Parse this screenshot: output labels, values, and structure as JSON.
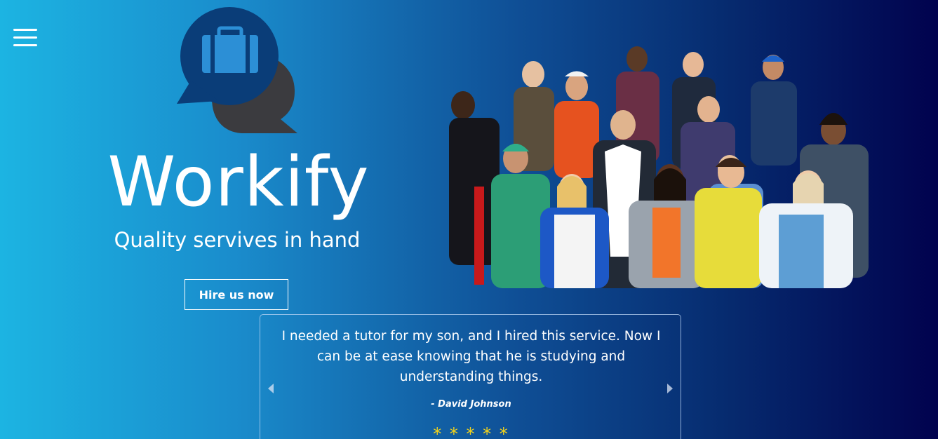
{
  "header": {
    "menu_icon": "hamburger-menu-icon",
    "logo_icon": "briefcase-chat-bubble-logo"
  },
  "hero": {
    "title": "Workify",
    "tagline": "Quality servives in hand",
    "cta_label": "Hire us now",
    "image": "group-of-diverse-professionals-photo"
  },
  "testimonial": {
    "quote": "I needed a tutor for my son, and I hired this service. Now I can be at ease knowing that he is studying and understanding things.",
    "author": "- David Johnson",
    "stars": "* * * * *",
    "prev_icon": "caret-left-icon",
    "next_icon": "caret-right-icon"
  },
  "colors": {
    "gradient_start": "#1cb4e2",
    "gradient_end": "#01024e",
    "logo_blue": "#0a3d78",
    "logo_gray": "#3b3b3f",
    "star_color": "#f2d31c"
  }
}
